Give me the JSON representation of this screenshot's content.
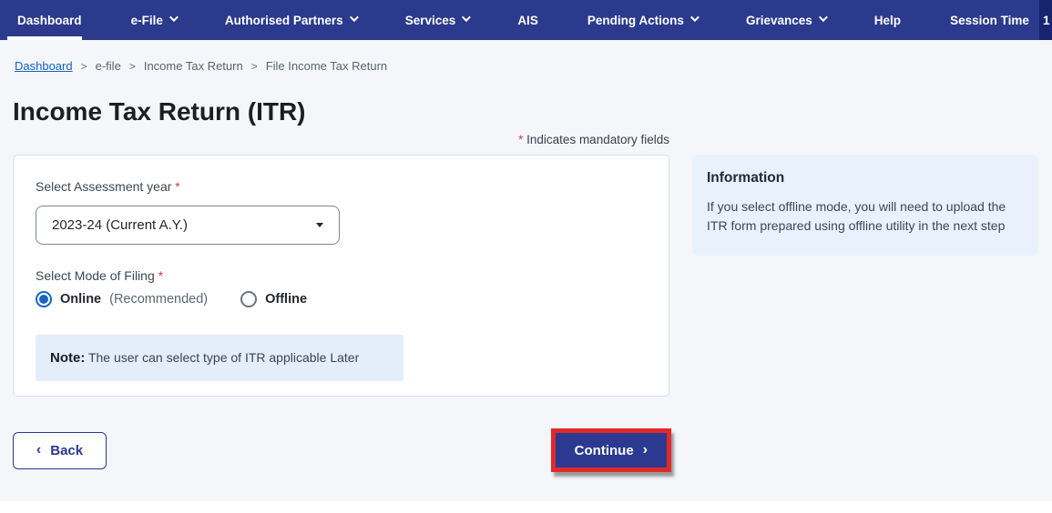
{
  "colors": {
    "navbar_bg": "#2b3a8d",
    "timer_bg": "#17246e",
    "page_bg": "#f4f6fa",
    "link_blue": "#1565c0",
    "primary_blue": "#2b3990",
    "highlight_red": "#e22929",
    "required_red": "#d23b3b",
    "info_panel_bg": "#e9f1fc",
    "note_bg": "#e4eefb",
    "radio_selected": "#1565c0"
  },
  "navbar": {
    "items": [
      {
        "label": "Dashboard",
        "active": true
      },
      {
        "label": "e-File"
      },
      {
        "label": "Authorised Partners"
      },
      {
        "label": "Services"
      },
      {
        "label": "AIS"
      },
      {
        "label": "Pending Actions"
      },
      {
        "label": "Grievances"
      },
      {
        "label": "Help"
      }
    ],
    "session_time_label": "Session Time",
    "session_timer_visible": "1"
  },
  "breadcrumb": {
    "separator": ">",
    "items": [
      "Dashboard",
      "e-file",
      "Income Tax Return",
      "File Income Tax Return"
    ]
  },
  "page": {
    "title": "Income Tax Return (ITR)",
    "asterisk": "*",
    "mandatory_hint": "Indicates mandatory fields"
  },
  "form": {
    "assessment_year_label": "Select Assessment year",
    "assessment_year_value": "2023-24 (Current A.Y.)",
    "mode_label": "Select Mode of Filing",
    "online_label": "Online",
    "online_suffix": "(Recommended)",
    "offline_label": "Offline",
    "note_prefix": "Note:",
    "note_text": "The user can select type of ITR applicable Later"
  },
  "info_panel": {
    "title": "Information",
    "body": "If you select offline mode, you will need to upload the ITR form prepared using offline utility in the next step"
  },
  "footer": {
    "back_chevron": "‹",
    "back_label": "Back",
    "continue_label": "Continue",
    "continue_chevron": "›"
  }
}
